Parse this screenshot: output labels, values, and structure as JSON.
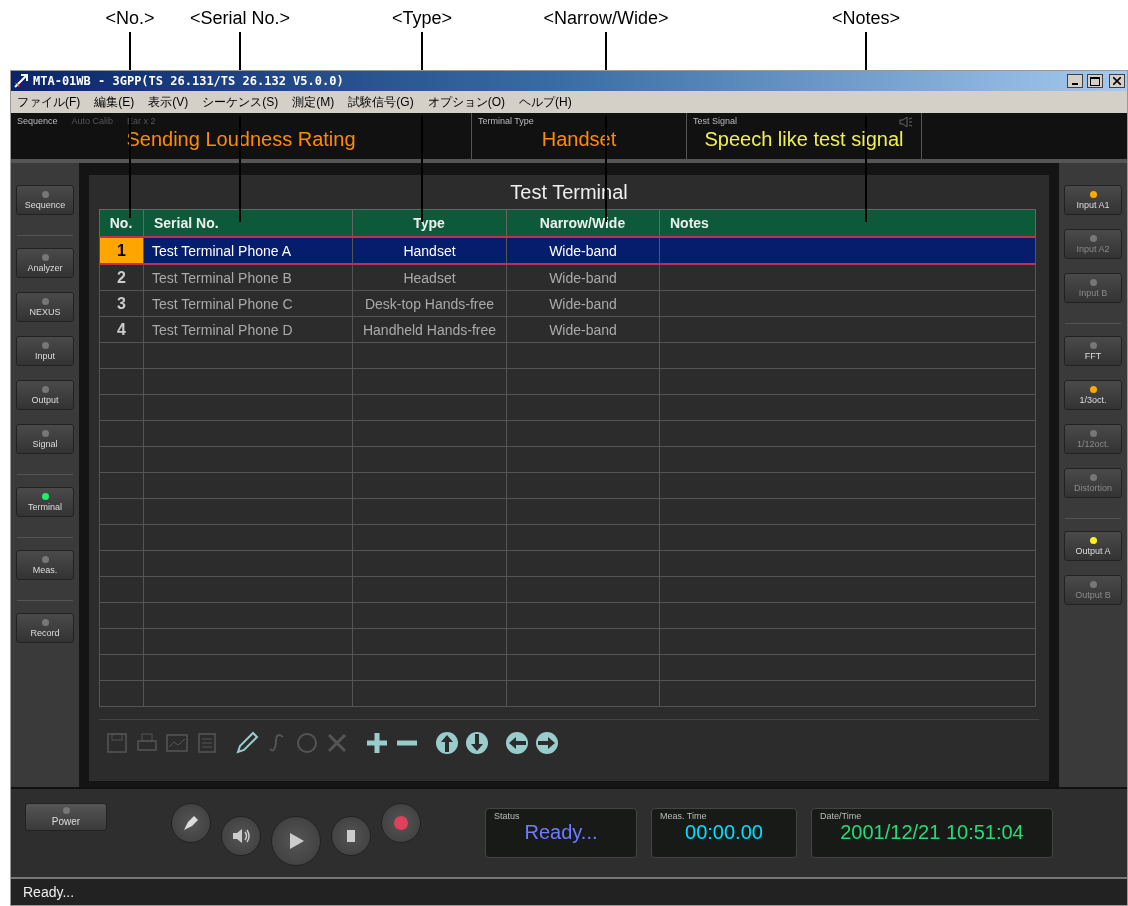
{
  "annotations": [
    "<No.>",
    "<Serial No.>",
    "<Type>",
    "<Narrow/Wide>",
    "<Notes>"
  ],
  "window": {
    "title": "MTA-01WB - 3GPP(TS 26.131/TS 26.132 V5.0.0)"
  },
  "menu": [
    "ファイル(F)",
    "編集(E)",
    "表示(V)",
    "シーケンス(S)",
    "測定(M)",
    "試験信号(G)",
    "オプション(O)",
    "ヘルプ(H)"
  ],
  "info_bar": {
    "sequence_labels": [
      "Sequence",
      "Auto Calib",
      "Ear x 2"
    ],
    "sequence": "Sending Loudness Rating",
    "terminal_type_label": "Terminal Type",
    "terminal_type": "Handset",
    "test_signal_label": "Test Signal",
    "test_signal": "Speech like test signal"
  },
  "left_panel": [
    [
      {
        "label": "Sequence",
        "color": "#777777",
        "disabled": false
      }
    ],
    [
      {
        "label": "Analyzer",
        "color": "#777777",
        "disabled": false
      },
      {
        "label": "NEXUS",
        "color": "#777777",
        "disabled": false
      },
      {
        "label": "Input",
        "color": "#777777",
        "disabled": false
      },
      {
        "label": "Output",
        "color": "#777777",
        "disabled": false
      },
      {
        "label": "Signal",
        "color": "#777777",
        "disabled": false
      }
    ],
    [
      {
        "label": "Terminal",
        "color": "#22ee66",
        "disabled": false
      }
    ],
    [
      {
        "label": "Meas.",
        "color": "#777777",
        "disabled": false
      }
    ],
    [
      {
        "label": "Record",
        "color": "#777777",
        "disabled": false
      }
    ]
  ],
  "right_panel": [
    [
      {
        "label": "Input A1",
        "color": "#ffaa00",
        "disabled": false
      },
      {
        "label": "Input A2",
        "color": "#777777",
        "disabled": true
      },
      {
        "label": "Input B",
        "color": "#777777",
        "disabled": true
      }
    ],
    [
      {
        "label": "FFT",
        "color": "#777777",
        "disabled": false
      },
      {
        "label": "1/3oct.",
        "color": "#ffaa00",
        "disabled": false
      },
      {
        "label": "1/12oct.",
        "color": "#777777",
        "disabled": true
      },
      {
        "label": "Distortion",
        "color": "#777777",
        "disabled": true
      }
    ],
    [
      {
        "label": "Output A",
        "color": "#ffee22",
        "disabled": false
      },
      {
        "label": "Output B",
        "color": "#777777",
        "disabled": true
      }
    ]
  ],
  "table": {
    "title": "Test Terminal",
    "columns": [
      "No.",
      "Serial No.",
      "Type",
      "Narrow/Wide",
      "Notes"
    ],
    "rows": [
      {
        "cells": [
          "1",
          "Test Terminal Phone A",
          "Handset",
          "Wide-band"
        ],
        "selected": true
      },
      {
        "cells": [
          "2",
          "Test Terminal Phone B",
          "Headset",
          "Wide-band"
        ],
        "selected": false
      },
      {
        "cells": [
          "3",
          "Test Terminal Phone C",
          "Desk-top Hands-free",
          "Wide-band"
        ],
        "selected": false
      },
      {
        "cells": [
          "4",
          "Test Terminal Phone D",
          "Handheld Hands-free",
          "Wide-band"
        ],
        "selected": false
      }
    ]
  },
  "toolbar": [
    {
      "kind": "save",
      "disabled": true
    },
    {
      "kind": "print",
      "disabled": true
    },
    {
      "kind": "graph",
      "disabled": true
    },
    {
      "kind": "list",
      "disabled": true
    },
    {
      "kind": "pencil",
      "disabled": false
    },
    {
      "kind": "script",
      "disabled": true
    },
    {
      "kind": "circle",
      "disabled": true
    },
    {
      "kind": "cross",
      "disabled": true
    },
    {
      "kind": "plus",
      "disabled": false
    },
    {
      "kind": "minus",
      "disabled": false
    },
    {
      "kind": "up",
      "disabled": false
    },
    {
      "kind": "down",
      "disabled": false
    },
    {
      "kind": "left",
      "disabled": false
    },
    {
      "kind": "right",
      "disabled": false
    }
  ],
  "power": {
    "label": "Power"
  },
  "transport": [
    {
      "kind": "pen"
    },
    {
      "kind": "speaker"
    },
    {
      "kind": "play"
    },
    {
      "kind": "stop"
    },
    {
      "kind": "record"
    }
  ],
  "readouts": [
    {
      "label": "Status",
      "value": "Ready...",
      "kind": "status"
    },
    {
      "label": "Meas. Time",
      "value": "00:00.00",
      "kind": "time"
    },
    {
      "label": "Date/Time",
      "value": "2001/12/21 10:51:04",
      "kind": "date"
    }
  ],
  "status_bar": "Ready..."
}
